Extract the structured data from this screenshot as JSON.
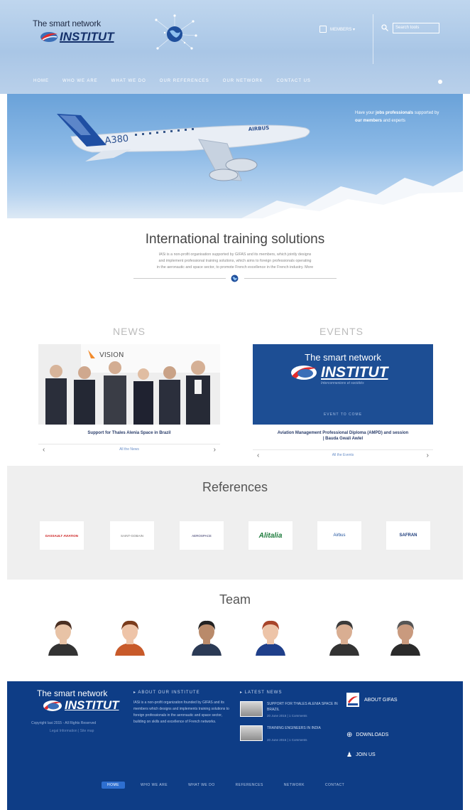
{
  "brand": {
    "tagline": "The smart network",
    "name": "INSTITUT",
    "subtitle": "Interconnexions et sociétés"
  },
  "header": {
    "member_label": "MEMBERS ▾",
    "search_placeholder": "Search tools",
    "nav": [
      "HOME",
      "WHO WE ARE",
      "WHAT WE DO",
      "OUR REFERENCES",
      "OUR NETWORK",
      "CONTACT US"
    ]
  },
  "hero": {
    "tag_prefix": "Have your ",
    "tag_bold1": "jobs professionals",
    "tag_mid": " supported by ",
    "tag_bold2": "our members",
    "tag_end": " and experts"
  },
  "intro": {
    "title": "International training solutions",
    "line1": "IASi is a non-profit organisation supported by GIFAS and its members, which jointly designs",
    "line2": "and implement professional training solutions, which aims to foreign professionals operating",
    "line3": "in the aeronautic and space sector, to promote French excellence in the French industry. More"
  },
  "news": {
    "title": "NEWS",
    "caption": "Support for Thales Alenia Space in Brazil",
    "more": "All the News"
  },
  "events": {
    "title": "EVENTS",
    "tag": "EVENT TO COME",
    "caption_line1": "Aviation Management Professional Diploma (AMPD) and session",
    "caption_line2": "| Bauda Gwali Awlel",
    "more": "All the Events"
  },
  "references": {
    "title": "References",
    "items": [
      {
        "label": "DASSAULT AVIATION",
        "color": "#c22"
      },
      {
        "label": "SAINT-GOBAIN",
        "color": "#777"
      },
      {
        "label": "AEROSPACE",
        "color": "#336"
      },
      {
        "label": "Alitalia",
        "color": "#1b7a3a"
      },
      {
        "label": "Airbus",
        "color": "#1a4f9c"
      },
      {
        "label": "SAFRAN",
        "color": "#1a3a7a"
      }
    ]
  },
  "team": {
    "title": "Team",
    "members": [
      {
        "hair": "#4a2f22",
        "skin": "#e8c3a6",
        "suit": "#333"
      },
      {
        "hair": "#7a3b1c",
        "skin": "#eec4a8",
        "suit": "#c85a2a"
      },
      {
        "hair": "#222",
        "skin": "#b98a6a",
        "suit": "#2b3a55"
      },
      {
        "hair": "#a8442a",
        "skin": "#edc4a8",
        "suit": "#1f3f8a"
      },
      {
        "hair": "#3a3a3a",
        "skin": "#d9ae92",
        "suit": "#333"
      },
      {
        "hair": "#555",
        "skin": "#c99a7e",
        "suit": "#2b2b2b"
      }
    ]
  },
  "footer": {
    "copyright": "Copyright Iasi 2015 - All Rights Reserved",
    "copyright2": "Legal Information | Site map",
    "about_title": "▸ ABOUT OUR INSTITUTE",
    "about_text": "IASi is a non-profit organization founded by GIFAS and its members which designs and implements training solutions to foreign professionals in the aeronautic and space sector, building on skills and excellence of French networks.",
    "news_title": "▸ LATEST NEWS",
    "news": [
      {
        "title": "Support for Thales Alenia Space in Brazil",
        "date": "20 June 2015 | 1 Comments"
      },
      {
        "title": "Training engineers in India",
        "date": "20 June 2015 | 1 Comments"
      }
    ],
    "links": [
      "ABOUT GIFAS",
      "DOWNLOADS",
      "JOIN US"
    ],
    "nav": [
      "HOME",
      "WHO WE ARE",
      "WHAT WE DO",
      "REFERENCES",
      "NETWORK",
      "CONTACT"
    ]
  }
}
